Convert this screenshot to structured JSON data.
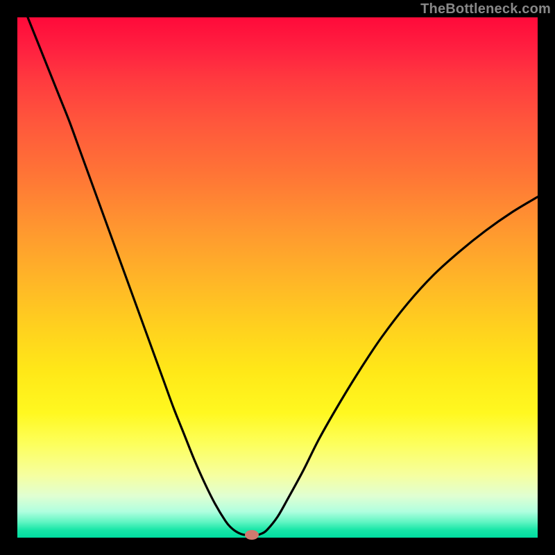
{
  "watermark": "TheBottleneck.com",
  "marker_color": "#d07a6f",
  "curve_color": "#000000",
  "chart_data": {
    "type": "line",
    "title": "",
    "xlabel": "",
    "ylabel": "",
    "xlim": [
      0,
      100
    ],
    "ylim": [
      0,
      100
    ],
    "grid": false,
    "x": [
      0,
      2,
      4,
      6,
      8,
      10,
      12,
      14,
      16,
      18,
      20,
      22,
      24,
      26,
      28,
      30,
      32,
      34,
      36,
      38,
      40,
      41,
      42,
      43,
      44,
      45,
      46,
      47,
      48,
      50,
      52,
      55,
      58,
      62,
      66,
      70,
      75,
      80,
      85,
      90,
      95,
      100
    ],
    "values": [
      null,
      100,
      95,
      90,
      85,
      80,
      74.5,
      69,
      63.5,
      58,
      52.5,
      47,
      41.5,
      36,
      30.5,
      25,
      20,
      15,
      10.5,
      6.5,
      3.2,
      2.0,
      1.2,
      0.7,
      0.5,
      0.5,
      0.5,
      0.8,
      1.5,
      4.0,
      7.5,
      13,
      19,
      26,
      32.5,
      38.5,
      45,
      50.5,
      55,
      59,
      62.5,
      65.5
    ],
    "minimum_x": 45,
    "minimum_y": 0.5,
    "annotations": []
  }
}
